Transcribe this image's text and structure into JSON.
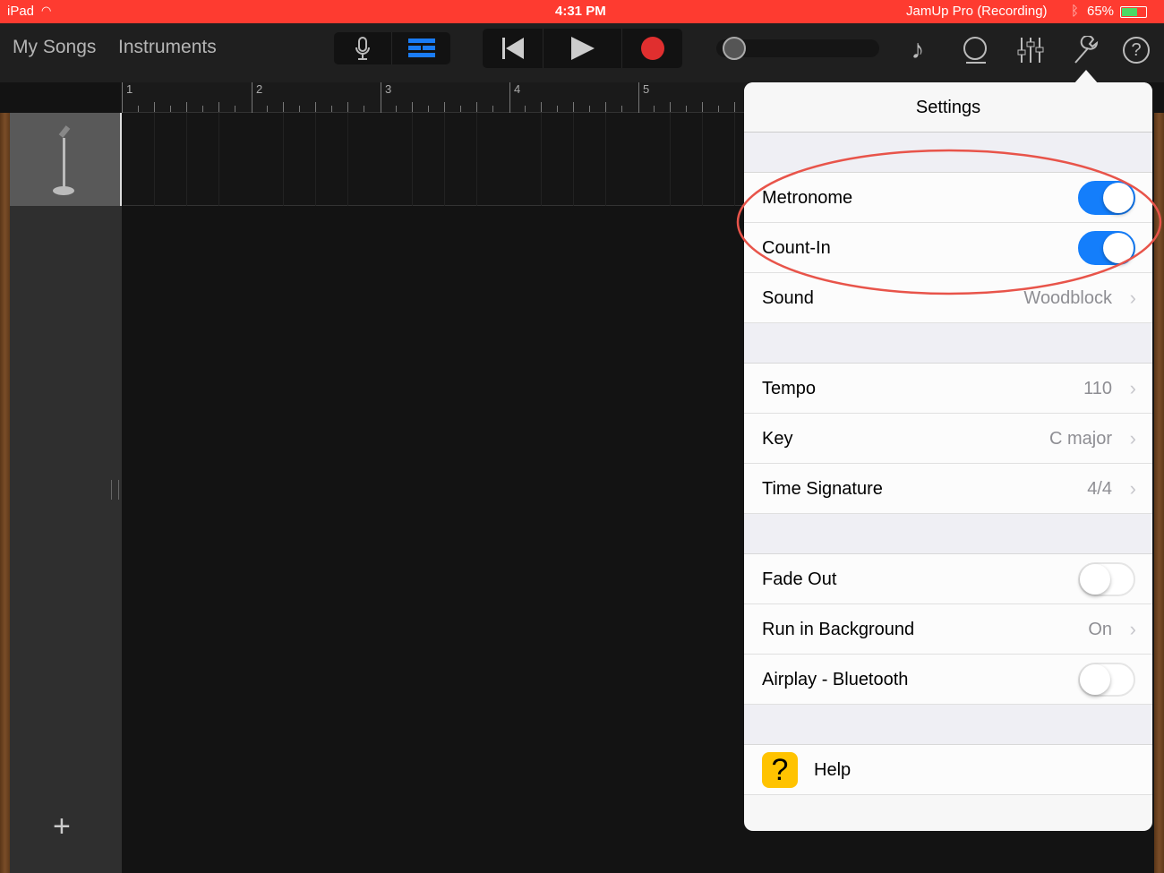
{
  "status": {
    "device": "iPad",
    "time": "4:31 PM",
    "app": "JamUp Pro (Recording)",
    "battery": "65%",
    "battery_color": "#4cd964"
  },
  "toolbar": {
    "my_songs": "My Songs",
    "instruments": "Instruments"
  },
  "ruler": {
    "bars": [
      "1",
      "2",
      "3",
      "4",
      "5"
    ]
  },
  "settings": {
    "title": "Settings",
    "metronome": {
      "label": "Metronome",
      "on": true
    },
    "count_in": {
      "label": "Count-In",
      "on": true
    },
    "sound": {
      "label": "Sound",
      "value": "Woodblock"
    },
    "tempo": {
      "label": "Tempo",
      "value": "110"
    },
    "key": {
      "label": "Key",
      "value": "C major"
    },
    "time_signature": {
      "label": "Time Signature",
      "value": "4/4"
    },
    "fade_out": {
      "label": "Fade Out",
      "on": false
    },
    "run_in_background": {
      "label": "Run in Background",
      "value": "On"
    },
    "airplay": {
      "label": "Airplay - Bluetooth",
      "on": false
    },
    "help": {
      "label": "Help",
      "icon": "?"
    }
  },
  "annotation_color": "#e8544a"
}
